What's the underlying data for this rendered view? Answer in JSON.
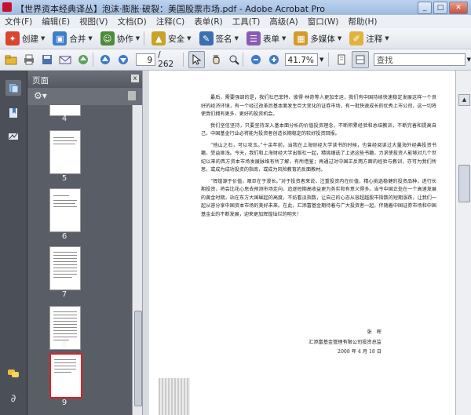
{
  "window": {
    "title": "【世界资本经典译丛】泡沫·膨胀·破裂：美国股票市场.pdf - Adobe Acrobat Pro",
    "min": "_",
    "max": "□",
    "close": "✕"
  },
  "menu": [
    "文件(F)",
    "编辑(E)",
    "视图(V)",
    "文档(D)",
    "注释(C)",
    "表单(R)",
    "工具(T)",
    "高级(A)",
    "窗口(W)",
    "帮助(H)"
  ],
  "toolbar1": [
    {
      "label": "创建",
      "icon": "create-icon",
      "color": "#d9452f"
    },
    {
      "label": "合并",
      "icon": "combine-icon",
      "color": "#3f7fc8"
    },
    {
      "label": "协作",
      "icon": "collaborate-icon",
      "color": "#4d8b3a"
    },
    {
      "label": "安全",
      "icon": "lock-icon",
      "color": "#c9a227"
    },
    {
      "label": "签名",
      "icon": "pen-icon",
      "color": "#3a6fb0"
    },
    {
      "label": "表单",
      "icon": "form-icon",
      "color": "#8a5bb5"
    },
    {
      "label": "多媒体",
      "icon": "multimedia-icon",
      "color": "#d49b2a"
    },
    {
      "label": "注释",
      "icon": "comment-icon",
      "color": "#e2b33c"
    }
  ],
  "toolbar2": {
    "page_current": "9",
    "page_total": "/ 262",
    "zoom": "41.7%",
    "search_placeholder": "查找"
  },
  "panel": {
    "title": "页面",
    "close": "x",
    "pages": [
      "4",
      "5",
      "6",
      "7",
      "8",
      "9"
    ],
    "selected": "9"
  },
  "document": {
    "paragraphs": [
      "最后，需要强调的是，我们社巴菲特、彼得·林奇等人更加幸运，我们有中国持续快速稳定发展这样一个良好的经济环境，有一个经过改革后基本面发生巨大变化的证券市场，有一批快速成长的优秀上市公司，这一切将使我们拥有更多、更好的投资机会。",
      "我们坚信坚持，只要坚持深入基本面分析的价值投资理念，不断积累经验和总结教训，不断完善和提高自己，中国基金行业必将能为投资者创造长期稳定的较好投资回报。",
      "“他山之石，可以攻玉。”十余年前，当我在上海财经大学读书的时候，也曾经阅读过大量海外经典投资书籍，受益匪浅。今天，我们和上海财经大学出版社一起，精挑细选了上述这些书籍，力求使投资人能够对几个世纪以来的西方资本市场发展脉络有所了解，有所借鉴；再通过对中国正反两方面的经验与教训，亦可为我们所思，或成为成功投资的指南，或成为风险教育的反面教材。",
      "“辉煌源于价值，艰巨在于漫长。”对于投资者来说，注重投资内在价值，精心挑选稳健的投资品种，进行长期投资，将会比花心思去预测市场走向、追逐短期高收益更为务实和有意义得多。当今中国正处在一个高速发展的黄金时期，站在东方大国崛起的高度，不妨看淡指数，让自己的心态从容超越股市指数的短期涨跌，让我们一起从容分享中国资本市场的美好未来。在此，汇添富基金期待着与广大投资者一起，伴随着中国证券市场和中国基金业的不断发展，迎来更加辉煌灿烂的明天！"
    ],
    "signature_name": "张　晖",
    "signature_org": "汇添富基金管理有限公司投资总监",
    "signature_date": "2008 年 4 月 18 日"
  }
}
